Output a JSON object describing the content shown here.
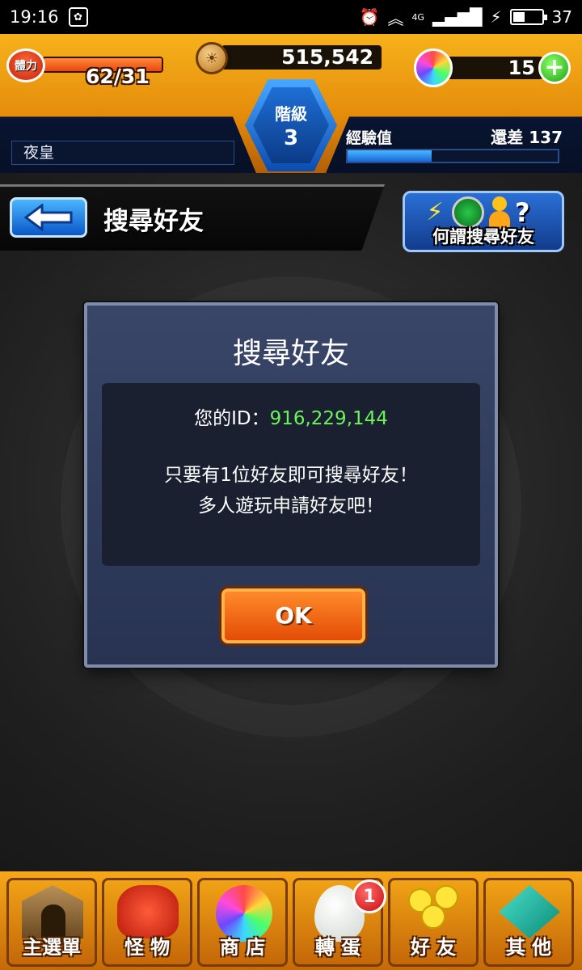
{
  "status_bar": {
    "time": "19:16",
    "battery_level": "37",
    "network": "4G"
  },
  "hud": {
    "stamina_label": "體力",
    "stamina": "62/31",
    "coins": "515,542",
    "orbs": "15",
    "rank_label": "階級",
    "rank": "3",
    "nickname": "夜皇",
    "exp_label": "經驗值",
    "exp_remaining": "還差 137",
    "exp_fraction": 0.4
  },
  "header": {
    "title": "搜尋好友",
    "help_label": "何謂搜尋好友"
  },
  "dialog": {
    "title": "搜尋好友",
    "id_label": "您的ID：",
    "id_value": "916,229,144",
    "message_line1": "只要有1位好友即可搜尋好友！",
    "message_line2": "多人遊玩申請好友吧！",
    "ok_label": "OK"
  },
  "bottom_nav": {
    "items": [
      {
        "label": "主選單",
        "icon": "castle-gate-icon"
      },
      {
        "label": "怪 物",
        "icon": "monster-icon"
      },
      {
        "label": "商 店",
        "icon": "rainbow-orb-icon"
      },
      {
        "label": "轉 蛋",
        "icon": "egg-icon"
      },
      {
        "label": "好 友",
        "icon": "friends-icon"
      },
      {
        "label": "其 他",
        "icon": "other-icon"
      }
    ],
    "egg_badge": "1"
  },
  "colors": {
    "accent_orange": "#f0a315",
    "id_green": "#6cf25a",
    "dialog_bg": "#283352",
    "header_blue": "#0a56c8"
  }
}
